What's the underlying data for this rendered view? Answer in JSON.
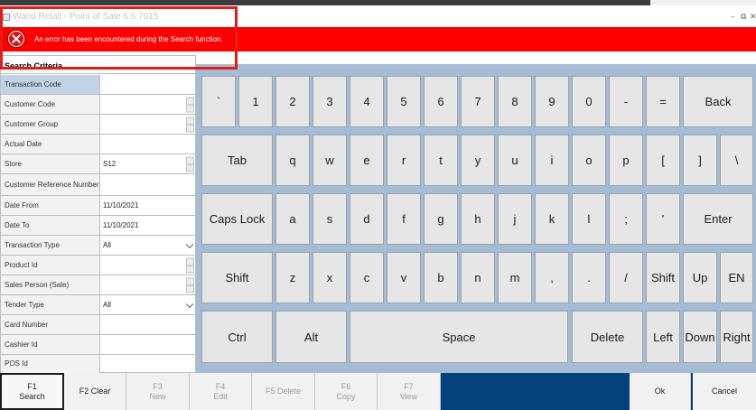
{
  "window": {
    "title": "Wand Retail - Point of Sale 6.6.7015",
    "minimize": "–",
    "restore": "⧉",
    "close": "✕"
  },
  "error": {
    "message": "An error has been encountered during the Search function."
  },
  "search": {
    "header": "Search Criteria",
    "rows": [
      {
        "label": "Transaction Code",
        "value": ""
      },
      {
        "label": "Customer Code",
        "value": ""
      },
      {
        "label": "Customer Group",
        "value": ""
      },
      {
        "label": "Actual Date",
        "value": ""
      },
      {
        "label": "Store",
        "value": "S12"
      },
      {
        "label": "Customer Reference Number",
        "value": ""
      },
      {
        "label": "Date From",
        "value": "11/10/2021"
      },
      {
        "label": "Date To",
        "value": "11/10/2021"
      },
      {
        "label": "Transaction Type",
        "value": "All"
      },
      {
        "label": "Product Id",
        "value": ""
      },
      {
        "label": "Sales Person (Sale)",
        "value": ""
      },
      {
        "label": "Tender Type",
        "value": "All"
      },
      {
        "label": "Card Number",
        "value": ""
      },
      {
        "label": "Cashier Id",
        "value": ""
      },
      {
        "label": "POS Id",
        "value": ""
      }
    ],
    "ellipsis": "..."
  },
  "keyboard": {
    "row1": [
      "`",
      "1",
      "2",
      "3",
      "4",
      "5",
      "6",
      "7",
      "8",
      "9",
      "0",
      "-",
      "=",
      "Back"
    ],
    "row2": [
      "Tab",
      "q",
      "w",
      "e",
      "r",
      "t",
      "y",
      "u",
      "i",
      "o",
      "p",
      "[",
      "]",
      "\\"
    ],
    "row3": [
      "Caps Lock",
      "a",
      "s",
      "d",
      "f",
      "g",
      "h",
      "j",
      "k",
      "l",
      ";",
      "'",
      "Enter"
    ],
    "row4": [
      "Shift",
      "z",
      "x",
      "c",
      "v",
      "b",
      "n",
      "m",
      ",",
      ".",
      "/",
      "Shift",
      "Up",
      "EN"
    ],
    "row5": [
      "Ctrl",
      "Alt",
      "Space",
      "Delete",
      "Left",
      "Down",
      "Right"
    ]
  },
  "functions": {
    "f1": {
      "key": "F1",
      "label": "Search"
    },
    "f2": {
      "text": "F2 Clear"
    },
    "f3": {
      "key": "F3",
      "label": "New"
    },
    "f4": {
      "key": "F4",
      "label": "Edit"
    },
    "f5": {
      "text": "F5 Delete"
    },
    "f6": {
      "key": "F6",
      "label": "Copy"
    },
    "f7": {
      "key": "F7",
      "label": "View"
    },
    "ok": "Ok",
    "cancel": "Cancel"
  }
}
